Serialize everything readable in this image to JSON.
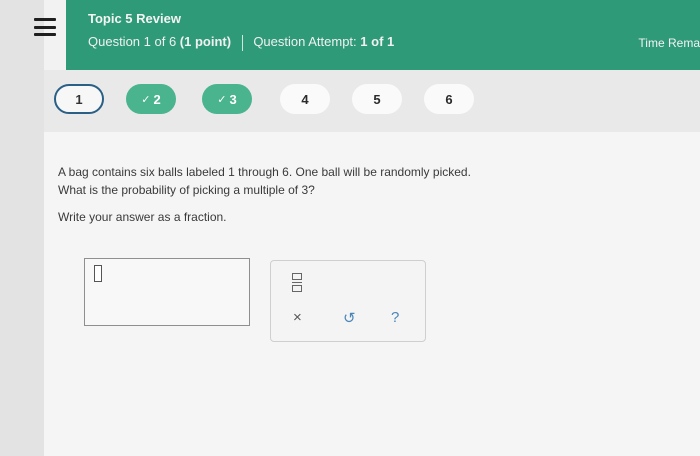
{
  "header": {
    "title": "Topic 5 Review",
    "question_label": "Question 1 of 6",
    "points": "(1 point)",
    "attempt_label": "Question Attempt:",
    "attempt_value": "1 of 1",
    "time_remaining": "Time Rema"
  },
  "question_nav": [
    {
      "label": "1",
      "state": "current"
    },
    {
      "label": "2",
      "state": "completed"
    },
    {
      "label": "3",
      "state": "completed"
    },
    {
      "label": "4",
      "state": "unanswered"
    },
    {
      "label": "5",
      "state": "unanswered"
    },
    {
      "label": "6",
      "state": "unanswered"
    }
  ],
  "question": {
    "line1": "A bag contains six balls labeled 1 through 6. One ball will be randomly picked.",
    "line2": "What is the probability of picking a multiple of 3?",
    "instruction": "Write your answer as a fraction."
  },
  "answer": {
    "value": ""
  },
  "tools": {
    "fraction_icon": "fraction-icon",
    "clear": "×",
    "undo": "↺",
    "help": "?"
  },
  "colors": {
    "header_bg": "#2f9a78",
    "completed_pill": "#49b48e",
    "current_border": "#2a5f86"
  }
}
